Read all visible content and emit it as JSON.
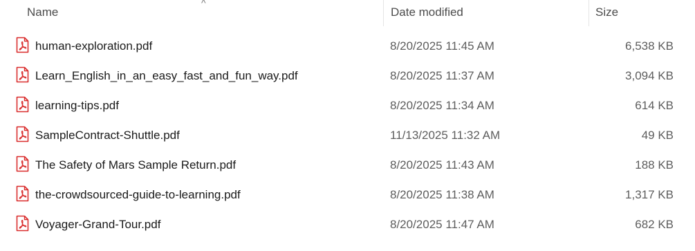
{
  "header": {
    "name_label": "Name",
    "date_label": "Date modified",
    "size_label": "Size",
    "sort_glyph": "^"
  },
  "files": [
    {
      "icon": "pdf-icon",
      "name": "human-exploration.pdf",
      "date": "8/20/2025 11:45 AM",
      "size": "6,538 KB"
    },
    {
      "icon": "pdf-icon",
      "name": "Learn_English_in_an_easy_fast_and_fun_way.pdf",
      "date": "8/20/2025 11:37 AM",
      "size": "3,094 KB"
    },
    {
      "icon": "pdf-icon",
      "name": "learning-tips.pdf",
      "date": "8/20/2025 11:34 AM",
      "size": "614 KB"
    },
    {
      "icon": "pdf-icon",
      "name": "SampleContract-Shuttle.pdf",
      "date": "11/13/2025 11:32 AM",
      "size": "49 KB"
    },
    {
      "icon": "pdf-icon",
      "name": "The Safety of Mars Sample Return.pdf",
      "date": "8/20/2025 11:43 AM",
      "size": "188 KB"
    },
    {
      "icon": "pdf-icon",
      "name": "the-crowdsourced-guide-to-learning.pdf",
      "date": "8/20/2025 11:38 AM",
      "size": "1,317 KB"
    },
    {
      "icon": "pdf-icon",
      "name": "Voyager-Grand-Tour.pdf",
      "date": "8/20/2025 11:47 AM",
      "size": "682 KB"
    }
  ],
  "colors": {
    "pdf_icon_red": "#d92b2b",
    "header_text": "#4c4c4c",
    "secondary_text": "#5d5d5d"
  }
}
